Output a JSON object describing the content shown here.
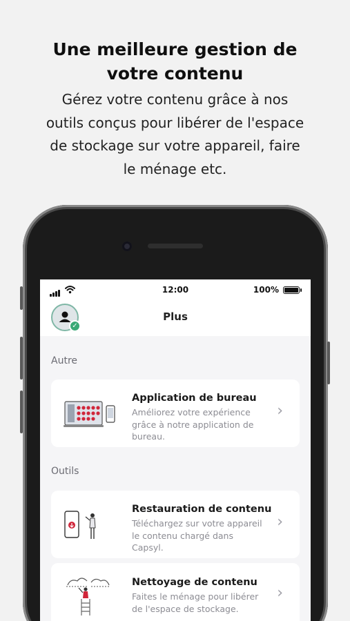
{
  "headline": {
    "title_line1": "Une meilleure gestion de",
    "title_line2": "votre contenu",
    "subtitle_line1": "Gérez votre contenu grâce à nos",
    "subtitle_line2": "outils conçus pour libérer de l'espace",
    "subtitle_line3": "de stockage sur votre appareil, faire",
    "subtitle_line4": "le ménage etc."
  },
  "status_bar": {
    "time": "12:00",
    "battery": "100%"
  },
  "header": {
    "title": "Plus"
  },
  "sections": {
    "autre": "Autre",
    "outils": "Outils"
  },
  "cards": [
    {
      "title": "Application de bureau",
      "desc_line1": "Améliorez votre expérience",
      "desc_line2": "grâce à notre application de",
      "desc_line3": "bureau."
    },
    {
      "title": "Restauration de contenu",
      "desc_line1": "Téléchargez sur votre appareil",
      "desc_line2": "le contenu chargé dans",
      "desc_line3": "Capsyl."
    },
    {
      "title": "Nettoyage de contenu",
      "desc_line1": "Faites le ménage pour libérer",
      "desc_line2": "de l'espace de stockage."
    }
  ],
  "colors": {
    "accent_red": "#d0263a",
    "success_green": "#3aa976"
  }
}
